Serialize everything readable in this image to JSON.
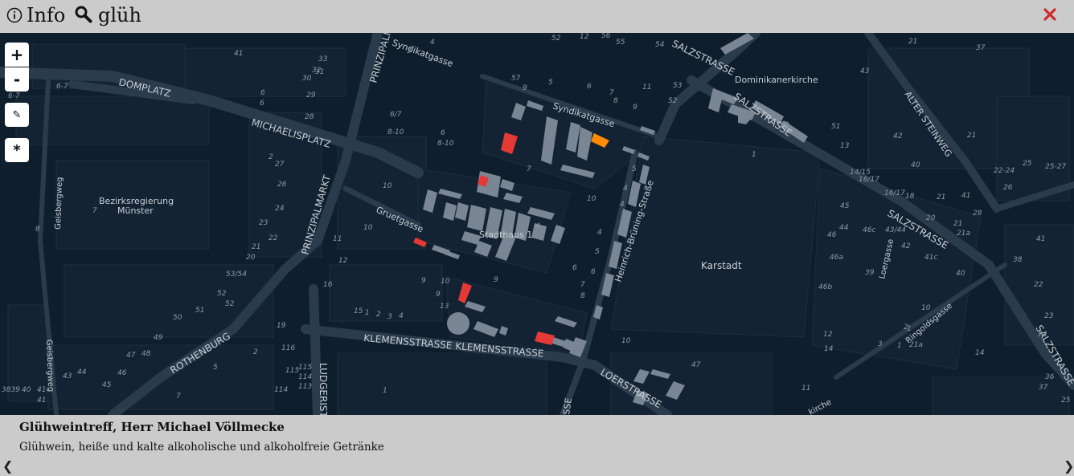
{
  "toolbar": {
    "info_label": "Info",
    "search_value": "glüh",
    "icons": {
      "info": "info-icon",
      "search": "search-icon",
      "close": "close-icon"
    },
    "close_color": "#d02b2b"
  },
  "map_controls": {
    "zoom_in_label": "+",
    "zoom_out_label": "-",
    "edit_label": "✎",
    "star_label": "*"
  },
  "map": {
    "streets": [
      "DOMPLATZ",
      "MICHAELISPLATZ",
      "PRINZIPALMARKT",
      "Syndikatgasse",
      "SALZSTRASSE",
      "Dominikanerkirche",
      "ALTER STEINWEG",
      "Bezirksregierung Münster",
      "Geisbergweg",
      "Gruetgasse",
      "Stadthaus 1",
      "Heinrich-Brüning-Straße",
      "Karstadt",
      "Loergasse",
      "Ringoldsgasse",
      "ROTHENBURG",
      "KLEMENSSTRASSE",
      "LUDGERISTRASSE",
      "LOERSTRASSE"
    ],
    "house_numbers": [
      "41",
      "33",
      "32",
      "31",
      "30",
      "29",
      "28",
      "6",
      "6",
      "6-7",
      "6-7",
      "2",
      "27",
      "26",
      "24",
      "23",
      "22",
      "21",
      "20",
      "53/54",
      "52",
      "52",
      "51",
      "50",
      "49",
      "48",
      "47",
      "46",
      "45",
      "44",
      "43",
      "40",
      "41",
      "41",
      "3839",
      "8",
      "7",
      "19",
      "116",
      "115",
      "114",
      "113",
      "115",
      "114",
      "2",
      "1",
      "7",
      "5",
      "4",
      "3",
      "2",
      "1",
      "15",
      "16",
      "9",
      "10",
      "9",
      "13",
      "12",
      "11",
      "10",
      "10",
      "8-10",
      "8-10",
      "6/7",
      "6",
      "3",
      "4",
      "5",
      "6",
      "7",
      "8",
      "9",
      "10",
      "11",
      "12",
      "56",
      "55",
      "54",
      "53",
      "52",
      "52",
      "57",
      "9",
      "7",
      "5",
      "4",
      "4",
      "4",
      "4",
      "5",
      "6",
      "6",
      "7",
      "8",
      "9",
      "10",
      "47",
      "11",
      "1",
      "50",
      "51",
      "13",
      "14/15",
      "16/17",
      "16/17",
      "18",
      "20",
      "21",
      "21",
      "22-24",
      "25",
      "26",
      "25-27",
      "28",
      "41",
      "41",
      "40",
      "42",
      "43",
      "44",
      "45",
      "46",
      "46a",
      "46b",
      "46c",
      "43/44",
      "42",
      "41c",
      "40",
      "39",
      "10",
      "2",
      "1",
      "3",
      "12",
      "14",
      "14",
      "38",
      "22",
      "23",
      "24",
      "25",
      "36",
      "37",
      "37",
      "21",
      "21",
      "21a",
      "21a",
      "1",
      "2"
    ],
    "highlight_colors": {
      "poi": "#e53935",
      "selected": "#ff8c00"
    }
  },
  "panel": {
    "title": "Glühweintreff, Herr Michael Völlmecke",
    "description": "Glühwein, heiße und kalte alkoholische und alkoholfreie Getränke",
    "prev_label": "❮",
    "next_label": "❯"
  }
}
